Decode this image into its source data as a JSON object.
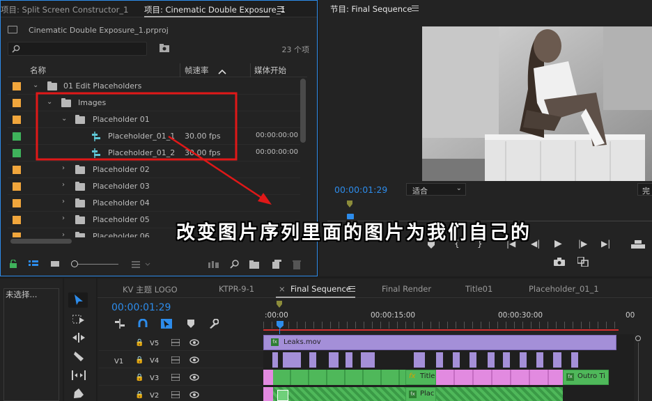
{
  "project_panel": {
    "tabs": [
      "项目: Split Screen Constructor_1",
      "项目: Cinematic Double Exposure_1"
    ],
    "file": "Cinematic Double Exposure_1.prproj",
    "search_value": "",
    "item_count": "23 个项",
    "col_name": "名称",
    "col_fps": "帧速率",
    "col_start": "媒体开始",
    "rows": [
      {
        "label": "01 Edit Placeholders",
        "fps": "",
        "start": "",
        "color": "#f1a63c"
      },
      {
        "label": "Images",
        "fps": "",
        "start": "",
        "color": "#f1a63c"
      },
      {
        "label": "Placeholder 01",
        "fps": "",
        "start": "",
        "color": "#f1a63c"
      },
      {
        "label": "Placeholder_01_1",
        "fps": "30.00 fps",
        "start": "00:00:00:00",
        "color": "#3fb35b"
      },
      {
        "label": "Placeholder_01_2",
        "fps": "30.00 fps",
        "start": "00:00:00:00",
        "color": "#3fb35b"
      },
      {
        "label": "Placeholder 02",
        "fps": "",
        "start": "",
        "color": "#f1a63c"
      },
      {
        "label": "Placeholder 03",
        "fps": "",
        "start": "",
        "color": "#f1a63c"
      },
      {
        "label": "Placeholder 04",
        "fps": "",
        "start": "",
        "color": "#f1a63c"
      },
      {
        "label": "Placeholder 05",
        "fps": "",
        "start": "",
        "color": "#f1a63c"
      },
      {
        "label": "Placeholder 06",
        "fps": "",
        "start": "",
        "color": "#f1a63c"
      }
    ]
  },
  "program": {
    "title": "节目: Final Sequence",
    "timecode": "00:00:01:29",
    "fit": "适合",
    "quality": "完"
  },
  "caption": "改变图片序列里面的图片为我们自己的",
  "source": {
    "none": "未选择..."
  },
  "timeline": {
    "tabs": [
      "KV 主题 LOGO",
      "KTPR-9-1",
      "Final Sequence",
      "Final Render",
      "Title01",
      "Placeholder_01_1"
    ],
    "close_mark": "×",
    "timecode": "00:00:01:29",
    "ruler": [
      ":00:00",
      "00:00:15:00",
      "00:00:30:00",
      "00"
    ],
    "tracks": [
      "V5",
      "V4",
      "V3",
      "V2"
    ],
    "source_patch": "V1",
    "clips": {
      "leaks": "Leaks.mov",
      "title": "Title",
      "outro": "Outro Ti",
      "plac": "Plac",
      "fx": "fx"
    }
  }
}
